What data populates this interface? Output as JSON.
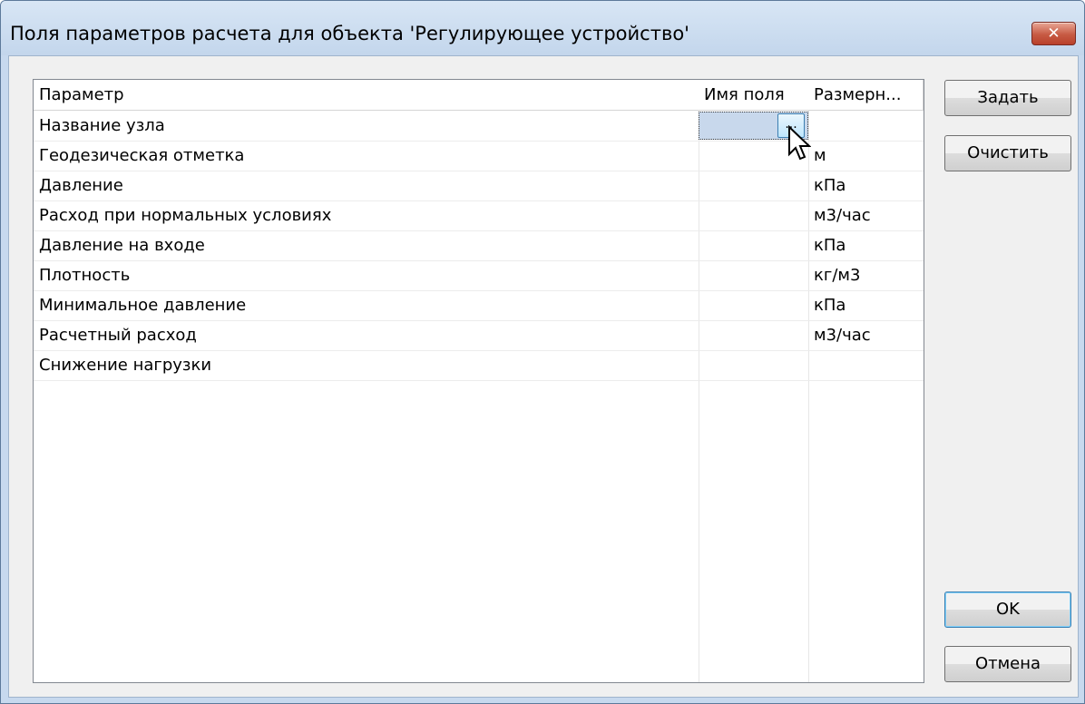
{
  "window": {
    "title": "Поля параметров расчета для объекта 'Регулирующее устройство'",
    "close_label": "✕"
  },
  "table": {
    "columns": [
      "Параметр",
      "Имя поля",
      "Размерн..."
    ],
    "rows": [
      {
        "param": "Название узла",
        "field": "",
        "unit": "",
        "editing": true
      },
      {
        "param": "Геодезическая отметка",
        "field": "",
        "unit": "м"
      },
      {
        "param": "Давление",
        "field": "",
        "unit": "кПа"
      },
      {
        "param": "Расход при нормальных условиях",
        "field": "",
        "unit": "м3/час"
      },
      {
        "param": "Давление на входе",
        "field": "",
        "unit": "кПа"
      },
      {
        "param": "Плотность",
        "field": "",
        "unit": "кг/м3"
      },
      {
        "param": "Минимальное давление",
        "field": "",
        "unit": "кПа"
      },
      {
        "param": "Расчетный расход",
        "field": "",
        "unit": "м3/час"
      },
      {
        "param": "Снижение нагрузки",
        "field": "",
        "unit": ""
      }
    ],
    "ellipsis_label": "..."
  },
  "buttons": {
    "set": "Задать",
    "clear": "Очистить",
    "ok": "OK",
    "cancel": "Отмена"
  },
  "colors": {
    "titlebar": "#c7d9ee",
    "close": "#c75a43",
    "selection": "#c8d8ec"
  }
}
